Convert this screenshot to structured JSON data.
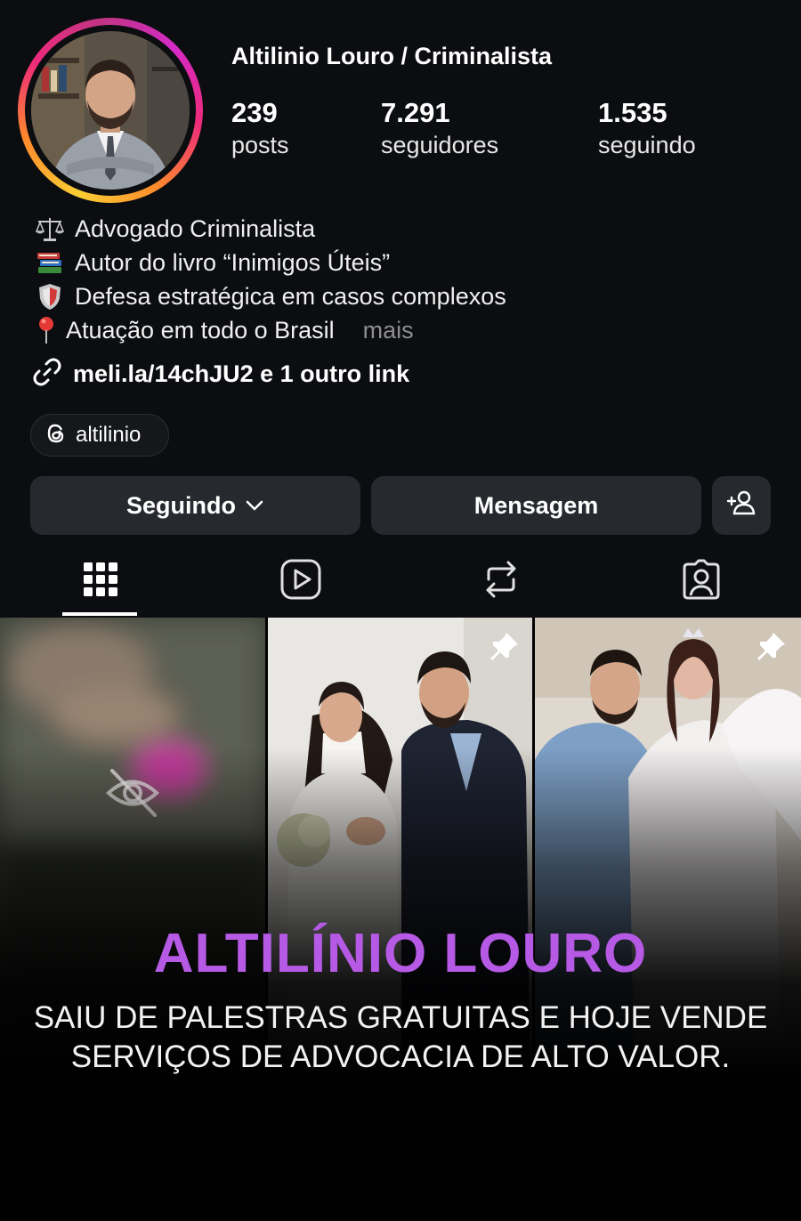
{
  "profile": {
    "username": "Altilinio Louro / Criminalista",
    "stats": [
      {
        "value": "239",
        "label": "posts"
      },
      {
        "value": "7.291",
        "label": "seguidores"
      },
      {
        "value": "1.535",
        "label": "seguindo"
      }
    ],
    "bio": [
      {
        "icon": "scales-icon",
        "text": "Advogado Criminalista"
      },
      {
        "icon": "books-icon",
        "text": "Autor do livro “Inimigos Úteis”"
      },
      {
        "icon": "shield-icon",
        "text": "Defesa estratégica em casos complexos"
      },
      {
        "icon": "pin-icon",
        "text": "Atuação em todo o Brasil"
      }
    ],
    "more_label": "mais",
    "link_text": "meli.la/14chJU2 e 1 outro link",
    "threads_handle": "altilinio"
  },
  "actions": {
    "following_label": "Seguindo",
    "message_label": "Mensagem"
  },
  "tabs": [
    "grid-icon",
    "reels-icon",
    "reposts-icon",
    "tagged-icon"
  ],
  "overlay": {
    "headline": "ALTILÍNIO LOURO",
    "subline_1": "SAIU DE PALESTRAS GRATUITAS E HOJE VENDE",
    "subline_2": "SERVIÇOS DE ADVOCACIA DE ALTO VALOR."
  },
  "colors": {
    "background": "#0b0d10",
    "button": "#26292e",
    "headline": "#b65ae6",
    "muted": "#8e8e8e"
  }
}
